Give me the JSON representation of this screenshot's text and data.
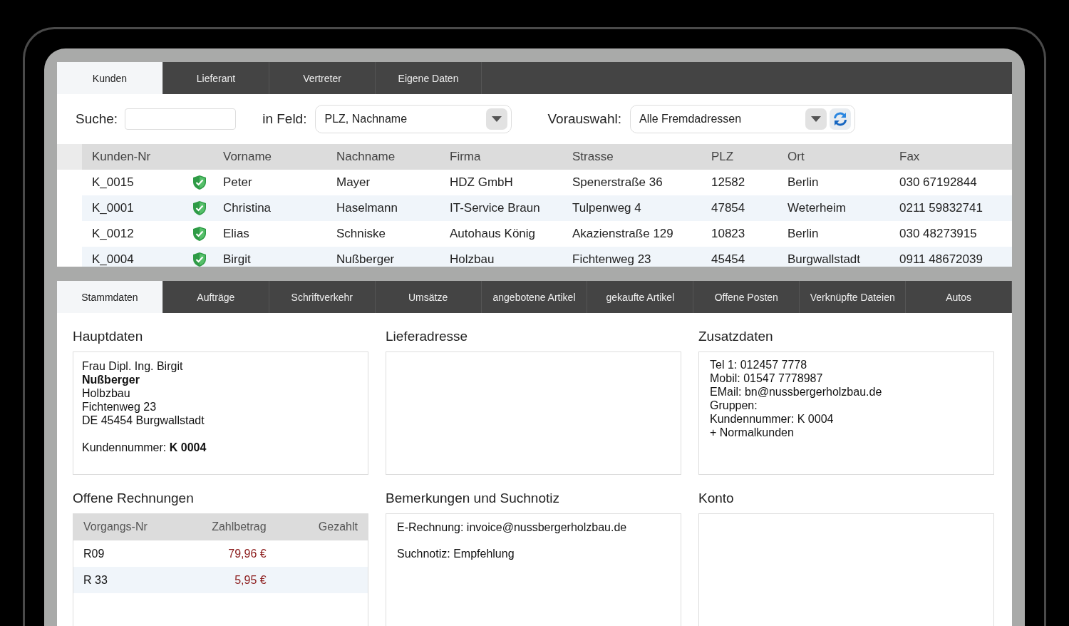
{
  "top_tabs": [
    {
      "label": "Kunden",
      "selected": true
    },
    {
      "label": "Lieferant",
      "selected": false
    },
    {
      "label": "Vertreter",
      "selected": false
    },
    {
      "label": "Eigene Daten",
      "selected": false
    }
  ],
  "search": {
    "label": "Suche:",
    "field_label": "in Feld:",
    "field_value": "PLZ, Nachname",
    "preselect_label": "Vorauswahl:",
    "preselect_value": "Alle Fremdadressen"
  },
  "table": {
    "columns": [
      "Kunden-Nr",
      "Vorname",
      "Nachname",
      "Firma",
      "Strasse",
      "PLZ",
      "Ort",
      "Fax"
    ],
    "rows": [
      {
        "cells": [
          "K_0015",
          "Peter",
          "Mayer",
          "HDZ GmbH",
          "Spenerstraße 36",
          "12582",
          "Berlin",
          "030 67192844"
        ]
      },
      {
        "cells": [
          "K_0001",
          "Christina",
          "Haselmann",
          "IT-Service Braun",
          "Tulpenweg 4",
          "47854",
          "Weterheim",
          "0211 59832741"
        ]
      },
      {
        "cells": [
          "K_0012",
          "Elias",
          "Schniske",
          "Autohaus König",
          "Akazienstraße 129",
          "10823",
          "Berlin",
          "030 48273915"
        ]
      },
      {
        "cells": [
          "K_0004",
          "Birgit",
          "Nußberger",
          "Holzbau",
          "Fichtenweg 23",
          "45454",
          "Burgwallstadt",
          "0911 48672039"
        ]
      }
    ]
  },
  "detail_tabs": [
    {
      "label": "Stammdaten",
      "selected": true
    },
    {
      "label": "Aufträge",
      "selected": false
    },
    {
      "label": "Schriftverkehr",
      "selected": false
    },
    {
      "label": "Umsätze",
      "selected": false
    },
    {
      "label": "angebotene Artikel",
      "selected": false
    },
    {
      "label": "gekaufte Artikel",
      "selected": false
    },
    {
      "label": "Offene Posten",
      "selected": false
    },
    {
      "label": "Verknüpfte Dateien",
      "selected": false
    },
    {
      "label": "Autos",
      "selected": false
    }
  ],
  "hauptdaten": {
    "title": "Hauptdaten",
    "blocks": [
      [
        {
          "text": "Frau Dipl. Ing. Birgit",
          "bold": false
        },
        {
          "text": "Nußberger",
          "bold": true
        },
        {
          "text": "Holbzbau",
          "bold": false
        },
        {
          "text": "Fichtenweg 23",
          "bold": false
        },
        {
          "text": "DE 45454 Burgwallstadt",
          "bold": false
        }
      ],
      [
        {
          "text": "Kundennummer: **K 0004**",
          "bold": false
        }
      ]
    ]
  },
  "lieferadresse": {
    "title": "Lieferadresse"
  },
  "zusatzdaten": {
    "title": "Zusatzdaten",
    "lines": [
      "Tel 1: 012457 7778",
      "Mobil: 01547 7778987",
      "EMail: bn@nussbergerholzbau.de",
      "Gruppen:",
      "Kundennummer: K 0004",
      "+ Normalkunden"
    ]
  },
  "offene_rechnungen": {
    "title": "Offene Rechnungen",
    "columns": [
      "Vorgangs-Nr",
      "Zahlbetrag",
      "Gezahlt"
    ],
    "rows": [
      {
        "number": "R09",
        "amount": "79,96 €"
      },
      {
        "number": "R 33",
        "amount": "5,95 €"
      }
    ]
  },
  "bemerkungen": {
    "title": "Bemerkungen und Suchnotiz",
    "paragraphs": [
      "E-Rechnung: invoice@nussbergerholzbau.de",
      "Suchnotiz: Empfehlung"
    ]
  },
  "konto": {
    "title": "Konto"
  }
}
